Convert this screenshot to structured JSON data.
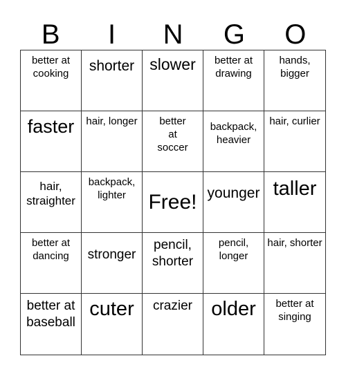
{
  "header": [
    "B",
    "I",
    "N",
    "G",
    "O"
  ],
  "cells": [
    "better at cooking",
    "shorter",
    "slower",
    "better at drawing",
    "hands, bigger",
    "faster",
    "hair, longer",
    "better at soccer",
    "backpack, heavier",
    "hair, curlier",
    "hair, straighter",
    "backpack, lighter",
    "Free!",
    "younger",
    "taller",
    "better at dancing",
    "stronger",
    "pencil, shorter",
    "pencil, longer",
    "hair, shorter",
    "better at baseball",
    "cuter",
    "crazier",
    "older",
    "better at singing"
  ]
}
